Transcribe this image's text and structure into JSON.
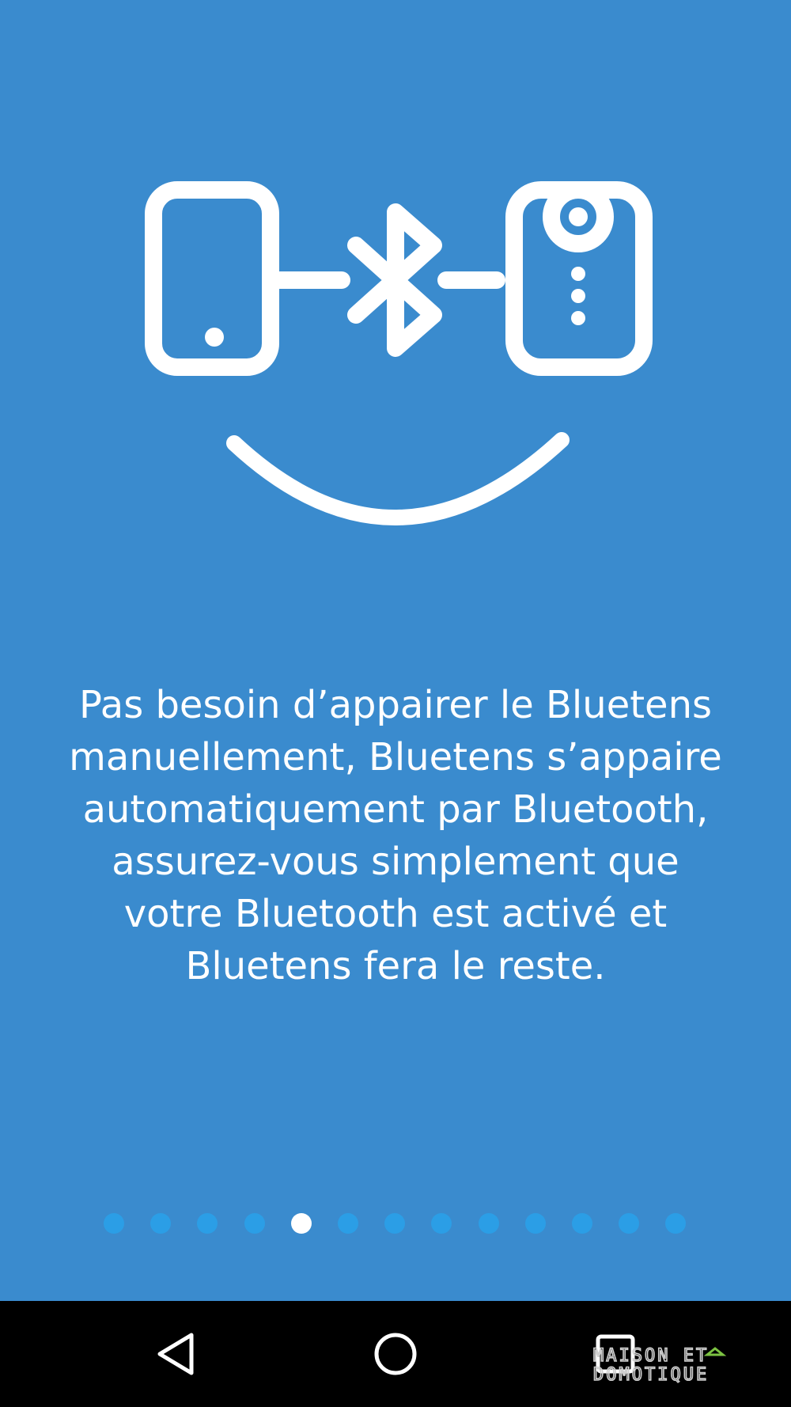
{
  "onboarding": {
    "message": "Pas besoin d’appairer le Bluetens\nmanuellement, Bluetens s’appaire\nautomatiquement par Bluetooth,\nassurez-vous simplement que\nvotre Bluetooth est activé et\nBluetens fera le reste.",
    "page_count": 13,
    "current_page": 5
  },
  "illustration": {
    "icons": [
      "phone-icon",
      "bluetooth-icon",
      "bluetens-device-icon",
      "smile-icon"
    ]
  },
  "navbar": {
    "icons": [
      "back-icon",
      "home-icon",
      "recents-icon"
    ]
  },
  "watermark": {
    "line1": "MAISON ET",
    "line2": "DOMOTIQUE"
  },
  "colors": {
    "background": "#3a8bce",
    "dot_inactive": "#2b9ee6",
    "dot_active": "#ffffff",
    "navbar": "#000000",
    "watermark_accent": "#7cc242"
  }
}
